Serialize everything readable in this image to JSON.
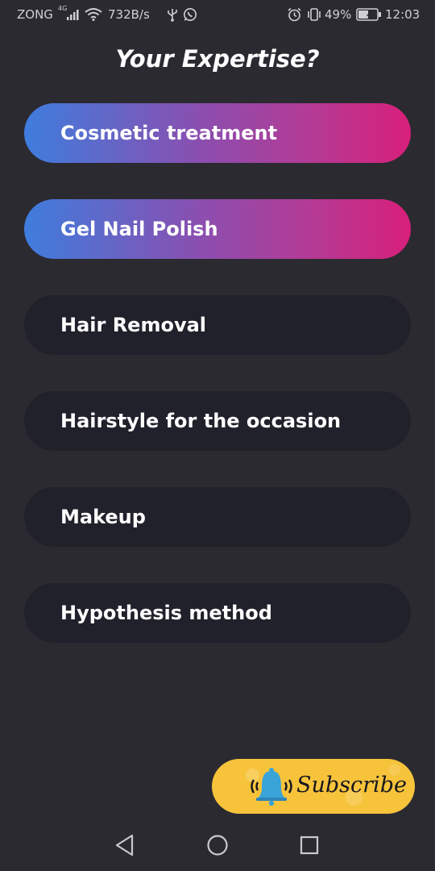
{
  "status_bar": {
    "carrier": "ZONG",
    "network_type": "4G",
    "speed": "732B/s",
    "battery": "49%",
    "time": "12:03"
  },
  "page": {
    "title": "Your Expertise?"
  },
  "options": [
    {
      "label": "Cosmetic treatment",
      "selected": true
    },
    {
      "label": "Gel Nail Polish",
      "selected": true
    },
    {
      "label": "Hair Removal",
      "selected": false
    },
    {
      "label": "Hairstyle for the occasion",
      "selected": false
    },
    {
      "label": "Makeup",
      "selected": false
    },
    {
      "label": "Hypothesis method",
      "selected": false
    }
  ],
  "subscribe": {
    "label": "Subscribe",
    "icon": "bell-icon"
  },
  "nav": {
    "back_icon": "back-triangle-icon",
    "home_icon": "home-circle-icon",
    "recents_icon": "recents-square-icon"
  },
  "colors": {
    "background": "#2b2a31",
    "option_bg": "#20212a",
    "gradient_start": "#3e7ddd",
    "gradient_end": "#d81f7a",
    "subscribe_bg": "#f6c33b",
    "bell": "#3aa3d8"
  }
}
